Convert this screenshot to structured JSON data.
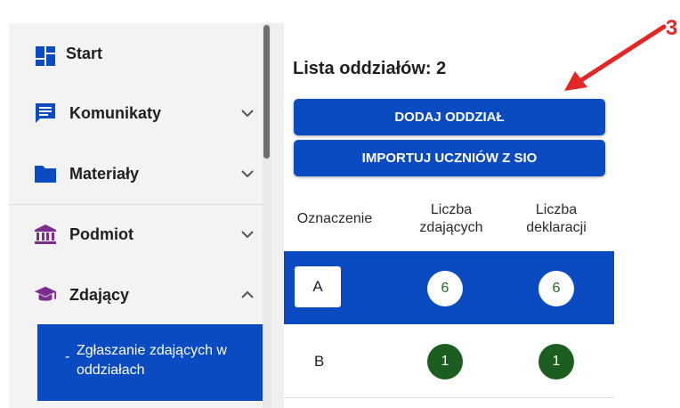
{
  "sidebar": {
    "items": [
      {
        "label": "Start",
        "icon": "dashboard-icon",
        "expandable": false
      },
      {
        "label": "Komunikaty",
        "icon": "message-icon",
        "expandable": true,
        "expanded": false
      },
      {
        "label": "Materiały",
        "icon": "folder-icon",
        "expandable": true,
        "expanded": false
      },
      {
        "label": "Podmiot",
        "icon": "institution-icon",
        "expandable": true,
        "expanded": false
      },
      {
        "label": "Zdający",
        "icon": "graduation-cap-icon",
        "expandable": true,
        "expanded": true
      }
    ],
    "subitem": {
      "dash": "-",
      "label": "Zgłaszanie zdających w oddziałach",
      "selected": true
    }
  },
  "main": {
    "title": "Lista oddziałów: 2",
    "buttons": {
      "add": "DODAJ ODDZIAŁ",
      "import": "IMPORTUJ UCZNIÓW Z SIO"
    },
    "table": {
      "headers": [
        "Oznaczenie",
        "Liczba zdających",
        "Liczba deklaracji"
      ],
      "rows": [
        {
          "oznaczenie": "A",
          "zdajacy": "6",
          "deklaracje": "6",
          "selected": true
        },
        {
          "oznaczenie": "B",
          "zdajacy": "1",
          "deklaracje": "1",
          "selected": false
        }
      ]
    }
  },
  "annotation": {
    "label": "3",
    "color": "#e32626"
  },
  "colors": {
    "primary": "#0a4bc2",
    "sidebar_bg": "#f3f3f3",
    "badge_green": "#1b5e20",
    "icon_blue": "#0a4bc2",
    "icon_purple": "#7b2e8e"
  }
}
